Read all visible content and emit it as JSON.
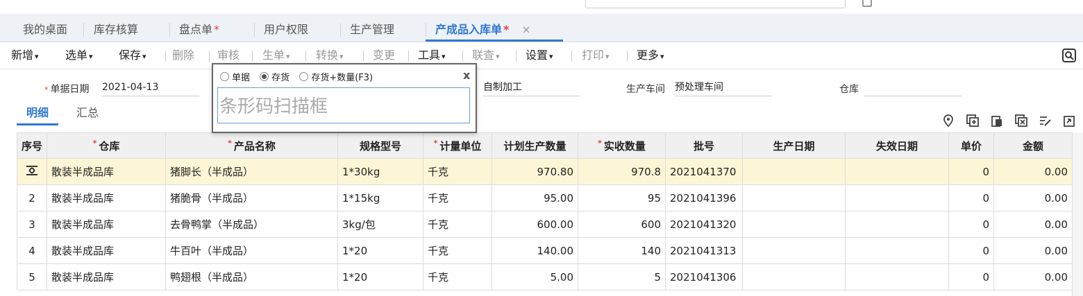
{
  "tabs": [
    {
      "label": "我的桌面",
      "star": ""
    },
    {
      "label": "库存核算",
      "star": ""
    },
    {
      "label": "盘点单",
      "star": "*"
    },
    {
      "label": "用户权限",
      "star": ""
    },
    {
      "label": "生产管理",
      "star": ""
    },
    {
      "label": "产成品入库单",
      "star": "*",
      "close": "×"
    }
  ],
  "toolbar": {
    "new": "新增",
    "select": "选单",
    "save": "保存",
    "delete": "删除",
    "audit": "审核",
    "gen": "生单",
    "convert": "转换",
    "change": "变更",
    "tools": "工具",
    "query": "联查",
    "settings": "设置",
    "print": "打印",
    "more": "更多",
    "chev": "▾"
  },
  "form": {
    "date_label": "单据日期",
    "date_value": "2021-04-13",
    "process_value": "自制加工",
    "workshop_label": "生产车间",
    "workshop_value": "预处理车间",
    "warehouse_label": "仓库",
    "warehouse_value": ""
  },
  "subtabs": {
    "detail": "明细",
    "summary": "汇总"
  },
  "popup": {
    "opt1": "单据",
    "opt2": "存货",
    "opt3": "存货+数量(F3)",
    "close": "x",
    "placeholder": "条形码扫描框"
  },
  "table": {
    "headers": [
      "序号",
      "仓库",
      "产品名称",
      "规格型号",
      "计量单位",
      "计划生产数量",
      "实收数量",
      "批号",
      "生产日期",
      "失效日期",
      "单价",
      "金额"
    ],
    "rows": [
      [
        "",
        "散装半成品库",
        "猪脚长（半成品）",
        "1*30kg",
        "千克",
        "970.80",
        "970.8",
        "2021041370",
        "",
        "",
        "0",
        "0.00"
      ],
      [
        "2",
        "散装半成品库",
        "猪脆骨（半成品）",
        "1*15kg",
        "千克",
        "95.00",
        "95",
        "2021041396",
        "",
        "",
        "0",
        "0.00"
      ],
      [
        "3",
        "散装半成品库",
        "去骨鸭掌（半成品）",
        "3kg/包",
        "千克",
        "600.00",
        "600",
        "2021041320",
        "",
        "",
        "0",
        "0.00"
      ],
      [
        "4",
        "散装半成品库",
        "牛百叶（半成品）",
        "1*20",
        "千克",
        "140.00",
        "140",
        "2021041313",
        "",
        "",
        "0",
        "0.00"
      ],
      [
        "5",
        "散装半成品库",
        "鸭翅根（半成品）",
        "1*20",
        "千克",
        "5.00",
        "5",
        "2021041306",
        "",
        "",
        "0",
        "0.00"
      ]
    ]
  }
}
